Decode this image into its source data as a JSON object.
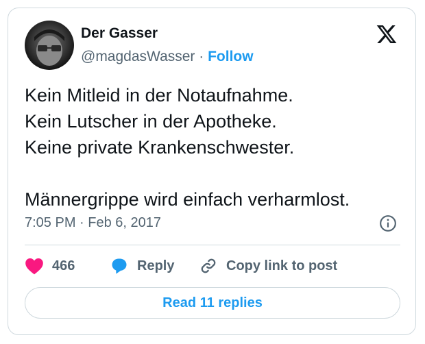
{
  "author": {
    "name": "Der Gasser",
    "handle": "@magdasWasser",
    "separator": "·",
    "follow_label": "Follow",
    "avatar_icon": "avatar-photo"
  },
  "brand": {
    "logo_icon": "x-logo-icon"
  },
  "tweet": {
    "lines": [
      "Kein Mitleid in der Notaufnahme.",
      "Kein Lutscher in der Apotheke.",
      "Keine private Krankenschwester.",
      "",
      "Männergrippe wird einfach verharmlost."
    ],
    "timestamp": "7:05 PM · Feb 6, 2017"
  },
  "actions": {
    "like_count": "466",
    "reply_label": "Reply",
    "copy_label": "Copy link to post"
  },
  "footer": {
    "read_replies_label": "Read 11 replies"
  },
  "colors": {
    "accent": "#1d9bf0",
    "heart": "#f91880",
    "text": "#0f1419",
    "muted": "#536471",
    "border": "#cfd9de"
  }
}
